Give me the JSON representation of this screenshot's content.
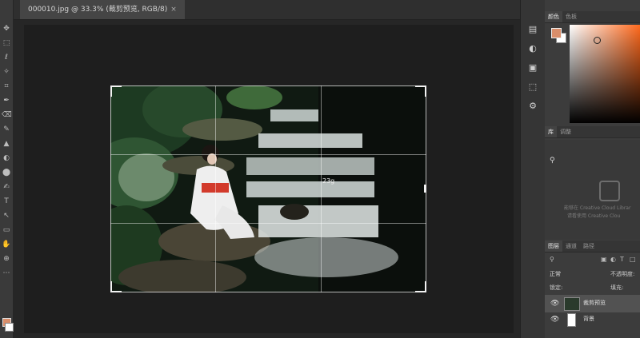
{
  "document_tab": {
    "title": "000010.jpg @ 33.3% (裁剪预览, RGB/8)",
    "close": "×"
  },
  "crop": {
    "dimension_label": "23g"
  },
  "toolbar": {
    "tools": [
      "✥",
      "⬚",
      "ℓ",
      "✧",
      "⌗",
      "✒",
      "⌫",
      "✎",
      "▲",
      "◐",
      "⬤",
      "✍",
      "T",
      "↖",
      "▭",
      "✋",
      "⊕",
      "⋯"
    ]
  },
  "mini_strip": {
    "icons": [
      "▤",
      "◐",
      "▣",
      "⬚",
      "⚙"
    ]
  },
  "color_panel": {
    "tabs": [
      "颜色",
      "色板"
    ],
    "fg_color": "#d98e6b",
    "bg_color": "#ffffff"
  },
  "library_panel": {
    "tabs": [
      "库",
      "调整"
    ],
    "message_line1": "能够在 Creative Cloud Librar",
    "message_line2": "请看使用 Creative Clou"
  },
  "layers_panel": {
    "tabs": [
      "图层",
      "通道",
      "路径"
    ],
    "blend_mode": "正常",
    "opacity_label": "不透明度:",
    "lock_label": "锁定:",
    "fill_label": "填充:",
    "layers": [
      {
        "name": "裁剪预览",
        "selected": true
      },
      {
        "name": "背景",
        "selected": false
      }
    ]
  }
}
